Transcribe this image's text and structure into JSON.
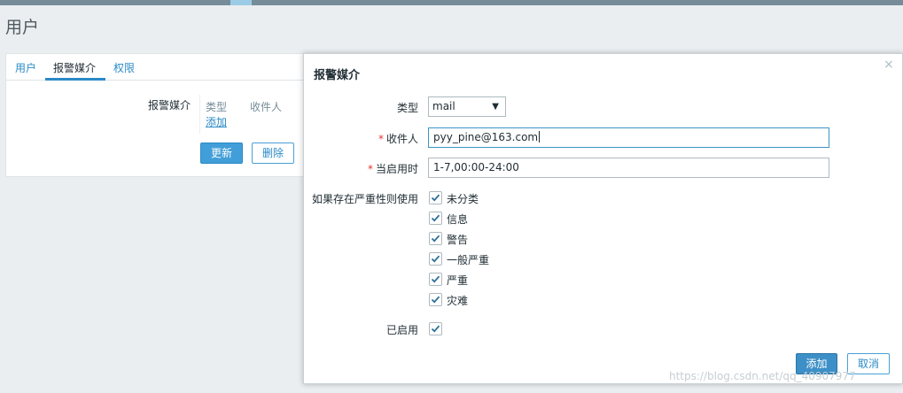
{
  "page": {
    "title": "用户"
  },
  "tabs": [
    "用户",
    "报警媒介",
    "权限"
  ],
  "media_section": {
    "label": "报警媒介",
    "col_type": "类型",
    "col_recipient": "收件人",
    "add_link": "添加",
    "update_button": "更新",
    "delete_button": "删除"
  },
  "dialog": {
    "title": "报警媒介",
    "close_glyph": "×",
    "type_label": "类型",
    "type_value": "mail",
    "recipient_label": "收件人",
    "recipient_value": "pyy_pine@163.com",
    "when_label": "当启用时",
    "when_value": "1-7,00:00-24:00",
    "severity_label": "如果存在严重性则使用",
    "severities": [
      "未分类",
      "信息",
      "警告",
      "一般严重",
      "严重",
      "灾难"
    ],
    "enabled_label": "已启用",
    "add_button": "添加",
    "cancel_button": "取消",
    "required_mark": "*"
  },
  "watermark": "https://blog.csdn.net/qq_40907977",
  "colors": {
    "accent": "#2b8ac7",
    "primary_button": "#3d90c7",
    "required": "#e33734"
  },
  "icons": {
    "close": "close-icon",
    "dropdown": "chevron-down-icon",
    "check": "check-icon"
  }
}
